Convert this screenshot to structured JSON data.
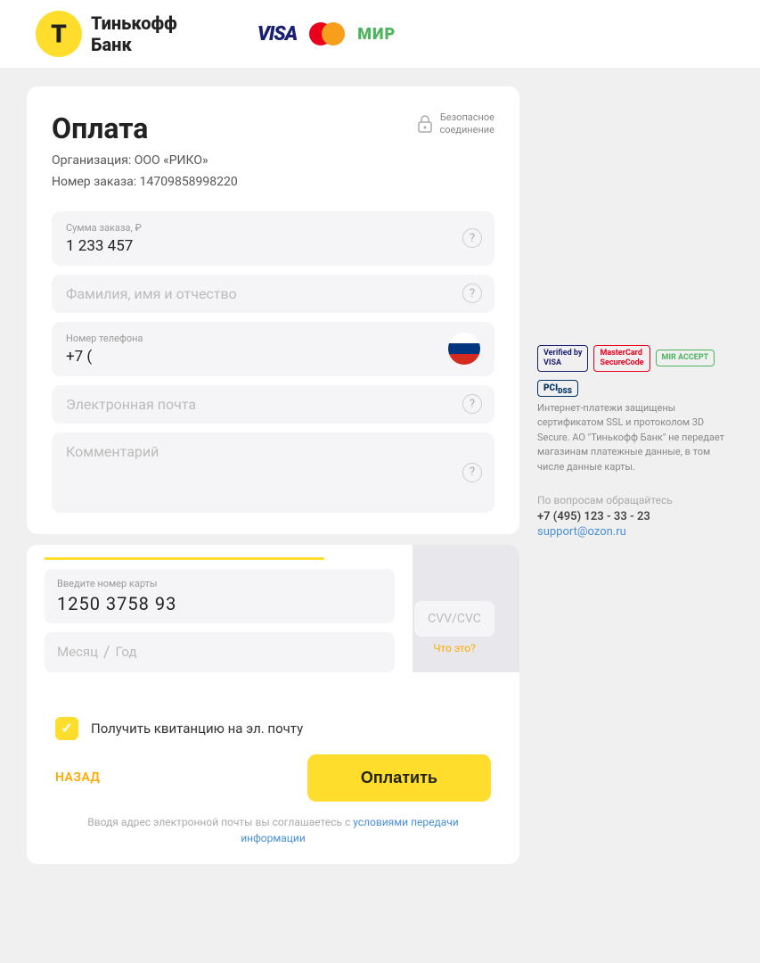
{
  "header": {
    "bank_name_line1": "Тинькофф",
    "bank_name_line2": "Банк",
    "visa_label": "VISA",
    "mir_label": "МИР"
  },
  "form": {
    "title": "Оплата",
    "secure_label": "Безопасное\nсоединение",
    "org_label": "Организация: ООО «РИКО»",
    "order_label": "Номер заказа: 14709858998220",
    "amount_label": "Сумма заказа, ₽",
    "amount_value": "1 233 457",
    "name_placeholder": "Фамилия, имя и отчество",
    "phone_label": "Номер телефона",
    "phone_value": "+7 (",
    "email_placeholder": "Электронная почта",
    "comment_placeholder": "Комментарий",
    "card_number_label": "Введите номер карты",
    "card_number_value": "1250  3758  93",
    "month_placeholder": "Месяц",
    "year_placeholder": "Год",
    "cvv_label": "CVV/CVC",
    "cvv_hint": "Что это?",
    "receipt_label": "Получить квитанцию на эл. почту",
    "back_label": "НАЗАД",
    "pay_label": "Оплатить",
    "terms_text": "Вводя адрес электронной почты вы соглашаетесь с ",
    "terms_link": "условиями передачи информации"
  },
  "security": {
    "verified_visa": "Verified by\nVISA",
    "mastercard_secure": "MasterCard\nSecureCode",
    "mir_accept": "MIR ACCEPT",
    "pci_dss": "PCI DSS",
    "description": "Интернет-платежи защищены сертификатом SSL и протоколом 3D Secure. АО \"Тинькофф Банк\" не передает магазинам платежные данные, в том числе данные карты.",
    "contact_label": "По вопросам обращайтесь",
    "phone": "+7 (495) 123 - 33 - 23",
    "email": "support@ozon.ru"
  }
}
